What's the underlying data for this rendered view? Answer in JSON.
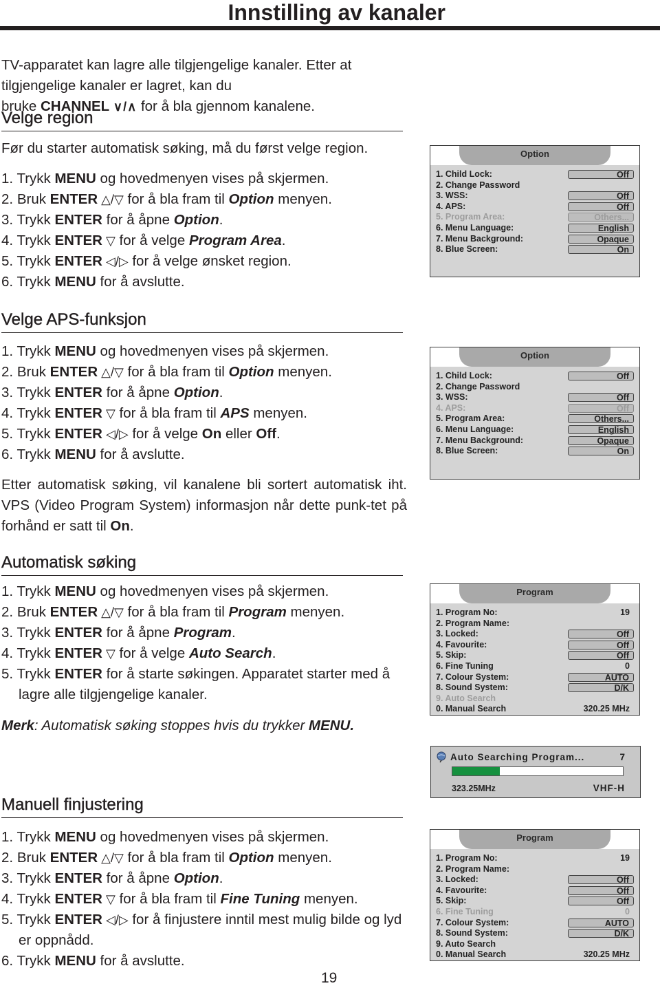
{
  "page": {
    "title": "Innstilling av kanaler",
    "page_number": "19"
  },
  "intro": {
    "line1": "TV-apparatet kan lagre alle tilgjengelige kanaler. Etter at tilgjengelige kanaler er lagret, kan du",
    "line2_pre": "bruke ",
    "line2_bold": "CHANNEL",
    "line2_symbols": "∨/∧",
    "line2_post": " for å bla gjennom kanalene."
  },
  "sections": {
    "region": {
      "heading": "Velge region",
      "lead": "Før du starter automatisk søking, må du først velge region.",
      "steps": [
        {
          "num": "1.",
          "pre": "Trykk ",
          "key": "MENU",
          "sym": "",
          "mid": " og hovedmenyen vises på skjermen.",
          "target": "",
          "post": ""
        },
        {
          "num": "2.",
          "pre": "Bruk ",
          "key": "ENTER",
          "sym": " △/▽",
          "mid": " for å bla fram til ",
          "target": "Option",
          "post": " menyen."
        },
        {
          "num": "3.",
          "pre": "Trykk ",
          "key": "ENTER",
          "sym": "",
          "mid": " for å åpne ",
          "target": "Option",
          "post": "."
        },
        {
          "num": "4.",
          "pre": "Trykk ",
          "key": "ENTER",
          "sym": " ▽",
          "mid": " for å velge ",
          "target": "Program Area",
          "post": "."
        },
        {
          "num": "5.",
          "pre": "Trykk ",
          "key": "ENTER",
          "sym": " ◁/▷",
          "mid": " for å velge ønsket region.",
          "target": "",
          "post": ""
        },
        {
          "num": "6.",
          "pre": "Trykk ",
          "key": "MENU",
          "sym": "",
          "mid": " for å avslutte.",
          "target": "",
          "post": ""
        }
      ]
    },
    "aps": {
      "heading": "Velge APS-funksjon",
      "steps": [
        {
          "num": "1.",
          "pre": "Trykk ",
          "key": "MENU",
          "sym": "",
          "mid": " og hovedmenyen vises på skjermen.",
          "target": "",
          "post": ""
        },
        {
          "num": "2.",
          "pre": "Bruk ",
          "key": "ENTER",
          "sym": " △/▽",
          "mid": " for å bla fram til ",
          "target": "Option",
          "post": " menyen."
        },
        {
          "num": "3.",
          "pre": "Trykk ",
          "key": "ENTER",
          "sym": "",
          "mid": " for å åpne ",
          "target": "Option",
          "post": "."
        },
        {
          "num": "4.",
          "pre": "Trykk ",
          "key": "ENTER",
          "sym": " ▽",
          "mid": " for å bla fram til ",
          "target": "APS",
          "post": " menyen."
        },
        {
          "num": "5.",
          "pre": "Trykk ",
          "key": "ENTER",
          "sym": " ◁/▷",
          "mid": " for å velge ",
          "on": "On",
          "mid2": " eller ",
          "off": "Off",
          "post": "."
        },
        {
          "num": "6.",
          "pre": "Trykk ",
          "key": "MENU",
          "sym": "",
          "mid": " for å avslutte.",
          "target": "",
          "post": ""
        }
      ],
      "note_pre": "Etter automatisk søking, vil kanalene bli sortert automatisk iht. VPS (Video Program System) informasjon når dette punk-tet på forhånd er satt til ",
      "note_bold": "On",
      "note_post": "."
    },
    "auto": {
      "heading": "Automatisk søking",
      "steps": [
        {
          "num": "1.",
          "pre": "Trykk ",
          "key": "MENU",
          "sym": "",
          "mid": " og hovedmenyen vises på skjermen.",
          "target": "",
          "post": ""
        },
        {
          "num": "2.",
          "pre": "Bruk ",
          "key": "ENTER",
          "sym": " △/▽",
          "mid": " for å bla fram til ",
          "target": "Program",
          "post": " menyen."
        },
        {
          "num": "3.",
          "pre": "Trykk ",
          "key": "ENTER",
          "sym": "",
          "mid": " for å åpne ",
          "target": "Program",
          "post": "."
        },
        {
          "num": "4.",
          "pre": "Trykk ",
          "key": "ENTER",
          "sym": " ▽",
          "mid": " for å velge ",
          "target": "Auto Search",
          "post": "."
        },
        {
          "num": "5.",
          "pre": "Trykk ",
          "key": "ENTER",
          "sym": "",
          "mid": " for å starte søkingen. Apparatet starter med å lagre alle tilgjengelige kanaler.",
          "target": "",
          "post": ""
        }
      ],
      "note_label": "Merk",
      "note_text": ": Automatisk søking stoppes hvis du trykker ",
      "note_key": "MENU."
    },
    "fine": {
      "heading": "Manuell finjustering",
      "steps": [
        {
          "num": "1.",
          "pre": "Trykk ",
          "key": "MENU",
          "sym": "",
          "mid": " og hovedmenyen vises på skjermen.",
          "target": "",
          "post": ""
        },
        {
          "num": "2.",
          "pre": "Bruk ",
          "key": "ENTER",
          "sym": " △/▽",
          "mid": " for å bla fram til ",
          "target": "Option",
          "post": " menyen."
        },
        {
          "num": "3.",
          "pre": "Trykk ",
          "key": "ENTER",
          "sym": "",
          "mid": " for å åpne ",
          "target": "Option",
          "post": "."
        },
        {
          "num": "4.",
          "pre": "Trykk ",
          "key": "ENTER",
          "sym": " ▽",
          "mid": " for å bla fram til ",
          "target": "Fine Tuning",
          "post": " menyen."
        },
        {
          "num": "5.",
          "pre": "Trykk ",
          "key": "ENTER",
          "sym": " ◁/▷",
          "mid": " for å finjustere inntil mest mulig bilde og lyd er oppnådd.",
          "target": "",
          "post": ""
        },
        {
          "num": "6.",
          "pre": "Trykk ",
          "key": "MENU",
          "sym": "",
          "mid": " for å avslutte.",
          "target": "",
          "post": ""
        }
      ]
    }
  },
  "menus": {
    "option_region": {
      "title": "Option",
      "rows": [
        {
          "label": "1. Child Lock:",
          "value": "Off",
          "box": true,
          "dim": false
        },
        {
          "label": "2. Change Password",
          "value": "",
          "box": false,
          "dim": false
        },
        {
          "label": "3. WSS:",
          "value": "Off",
          "box": true,
          "dim": false
        },
        {
          "label": "4. APS:",
          "value": "Off",
          "box": true,
          "dim": false
        },
        {
          "label": "5. Program Area:",
          "value": "Others...",
          "box": true,
          "dim": true
        },
        {
          "label": "6. Menu Language:",
          "value": "English",
          "box": true,
          "dim": false
        },
        {
          "label": "7. Menu Background:",
          "value": "Opaque",
          "box": true,
          "dim": false
        },
        {
          "label": "8. Blue Screen:",
          "value": "On",
          "box": true,
          "dim": false
        }
      ]
    },
    "option_aps": {
      "title": "Option",
      "rows": [
        {
          "label": "1. Child Lock:",
          "value": "Off",
          "box": true,
          "dim": false
        },
        {
          "label": "2. Change Password",
          "value": "",
          "box": false,
          "dim": false
        },
        {
          "label": "3. WSS:",
          "value": "Off",
          "box": true,
          "dim": false
        },
        {
          "label": "4. APS:",
          "value": "Off",
          "box": true,
          "dim": true
        },
        {
          "label": "5. Program Area:",
          "value": "Others...",
          "box": true,
          "dim": false
        },
        {
          "label": "6. Menu Language:",
          "value": "English",
          "box": true,
          "dim": false
        },
        {
          "label": "7. Menu Background:",
          "value": "Opaque",
          "box": true,
          "dim": false
        },
        {
          "label": "8. Blue Screen:",
          "value": "On",
          "box": true,
          "dim": false
        }
      ]
    },
    "program_auto": {
      "title": "Program",
      "rows": [
        {
          "label": "1. Program No:",
          "value": "19",
          "box": false,
          "dim": false
        },
        {
          "label": "2. Program Name:",
          "value": "",
          "box": false,
          "dim": false
        },
        {
          "label": "3. Locked:",
          "value": "Off",
          "box": true,
          "dim": false
        },
        {
          "label": "4. Favourite:",
          "value": "Off",
          "box": true,
          "dim": false
        },
        {
          "label": "5. Skip:",
          "value": "Off",
          "box": true,
          "dim": false
        },
        {
          "label": "6. Fine Tuning",
          "value": "0",
          "box": false,
          "dim": false
        },
        {
          "label": "7. Colour System:",
          "value": "AUTO",
          "box": true,
          "dim": false
        },
        {
          "label": "8. Sound System:",
          "value": "D/K",
          "box": true,
          "dim": false
        },
        {
          "label": "9. Auto Search",
          "value": "",
          "box": false,
          "dim": true
        },
        {
          "label": "0. Manual Search",
          "value": "320.25 MHz",
          "box": false,
          "dim": false
        }
      ]
    },
    "program_fine": {
      "title": "Program",
      "rows": [
        {
          "label": "1. Program No:",
          "value": "19",
          "box": false,
          "dim": false
        },
        {
          "label": "2. Program Name:",
          "value": "",
          "box": false,
          "dim": false
        },
        {
          "label": "3. Locked:",
          "value": "Off",
          "box": true,
          "dim": false
        },
        {
          "label": "4. Favourite:",
          "value": "Off",
          "box": true,
          "dim": false
        },
        {
          "label": "5. Skip:",
          "value": "Off",
          "box": true,
          "dim": false
        },
        {
          "label": "6. Fine Tuning",
          "value": "0",
          "box": false,
          "dim": true
        },
        {
          "label": "7. Colour System:",
          "value": "AUTO",
          "box": true,
          "dim": false
        },
        {
          "label": "8. Sound System:",
          "value": "D/K",
          "box": true,
          "dim": false
        },
        {
          "label": "9. Auto Search",
          "value": "",
          "box": false,
          "dim": false
        },
        {
          "label": "0. Manual Search",
          "value": "320.25 MHz",
          "box": false,
          "dim": false
        }
      ]
    }
  },
  "auto_search": {
    "title": "Auto Searching Program...",
    "count": "7",
    "progress_fraction": 0.28,
    "frequency": "323.25MHz",
    "band": "VHF-H",
    "colors": {
      "progress": "#16913f",
      "track": "#ffffff"
    }
  }
}
